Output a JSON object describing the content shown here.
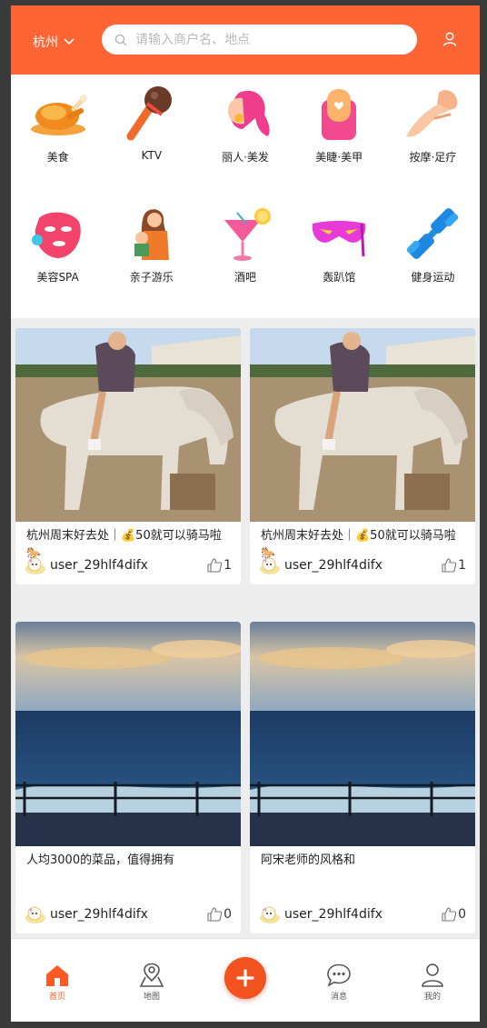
{
  "header": {
    "city": "杭州",
    "search_placeholder": "请输入商户名、地点"
  },
  "categories": [
    {
      "label": "美食",
      "icon": "roast-chicken-icon"
    },
    {
      "label": "KTV",
      "icon": "microphone-icon"
    },
    {
      "label": "丽人·美发",
      "icon": "hair-icon"
    },
    {
      "label": "美睫·美甲",
      "icon": "nail-icon"
    },
    {
      "label": "按摩·足疗",
      "icon": "massage-hand-icon"
    },
    {
      "label": "美容SPA",
      "icon": "face-mask-icon"
    },
    {
      "label": "亲子游乐",
      "icon": "parent-child-icon"
    },
    {
      "label": "酒吧",
      "icon": "cocktail-icon"
    },
    {
      "label": "轰趴馆",
      "icon": "party-mask-icon"
    },
    {
      "label": "健身运动",
      "icon": "dumbbell-icon"
    }
  ],
  "feed": [
    {
      "title": "杭州周末好去处｜💰50就可以骑马啦🐎",
      "user": "user_29hlf4difx",
      "likes": "1",
      "photo": "horse-riding-photo"
    },
    {
      "title": "杭州周末好去处｜💰50就可以骑马啦🐎",
      "user": "user_29hlf4difx",
      "likes": "1",
      "photo": "horse-riding-photo"
    },
    {
      "title": "人均3000的菜品，值得拥有",
      "user": "user_29hlf4difx",
      "likes": "0",
      "photo": "seaside-sunset-photo"
    },
    {
      "title": "阿宋老师的风格和",
      "user": "user_29hlf4difx",
      "likes": "0",
      "photo": "seaside-sunset-photo"
    }
  ],
  "tabbar": [
    {
      "label": "首页",
      "icon": "home-icon",
      "active": true
    },
    {
      "label": "地图",
      "icon": "map-pin-icon",
      "active": false
    },
    {
      "label": "消息",
      "icon": "chat-bubble-icon",
      "active": false
    },
    {
      "label": "我的",
      "icon": "person-icon",
      "active": false
    }
  ],
  "colors": {
    "brand": "#ff6434",
    "active_tab": "#ff5a24",
    "plus_button": "#f2521e"
  }
}
